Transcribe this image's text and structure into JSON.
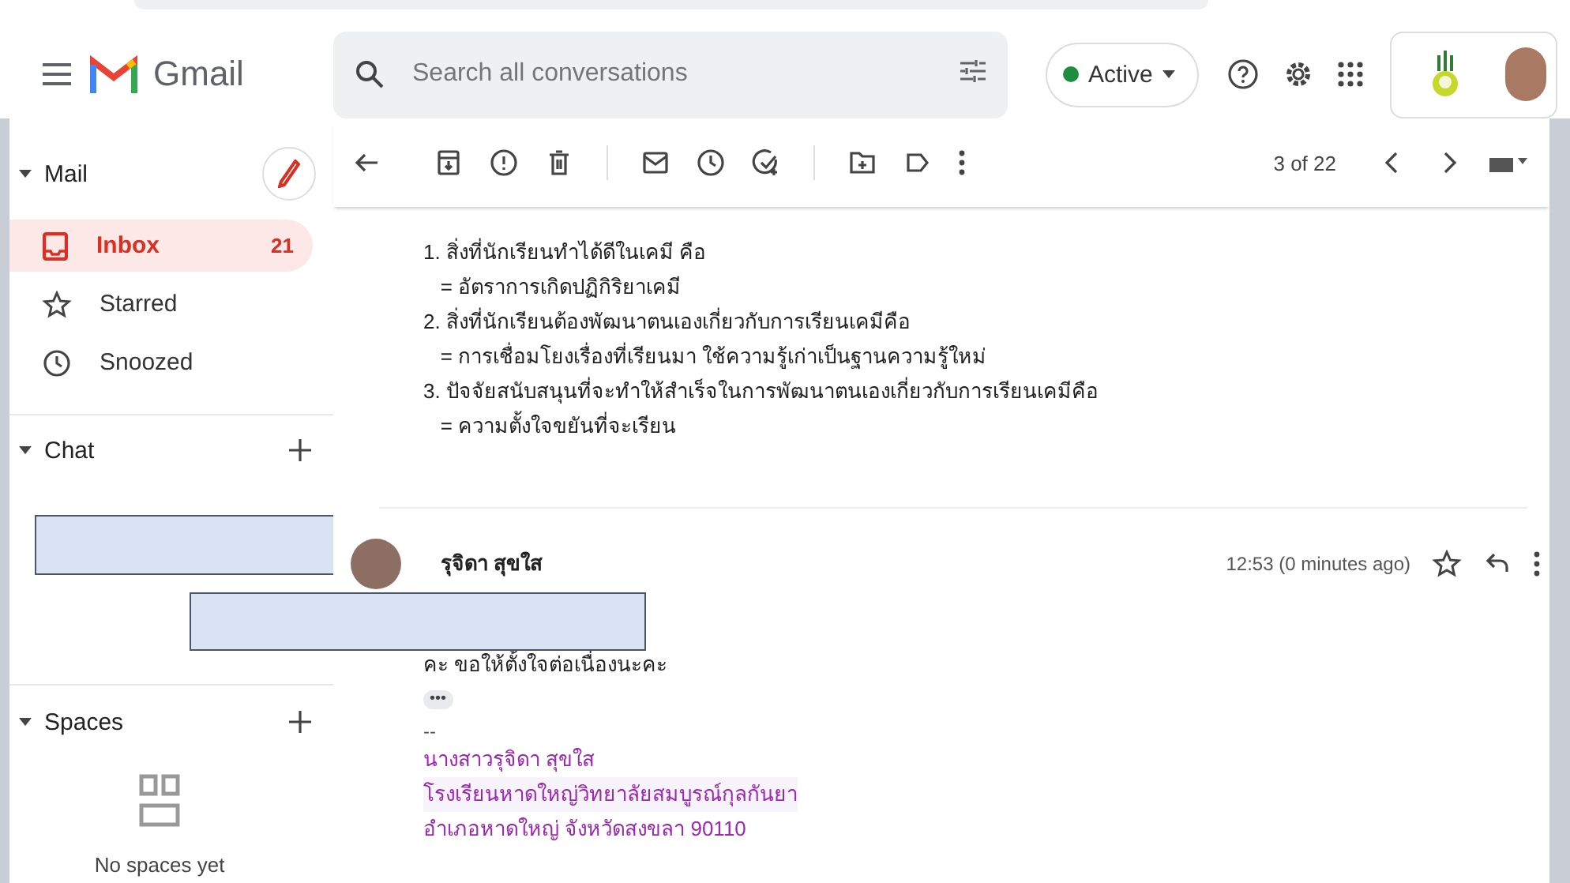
{
  "header": {
    "app_name": "Gmail",
    "search": {
      "placeholder": "Search all conversations"
    },
    "status": {
      "label": "Active"
    }
  },
  "sidebar": {
    "mail_section": {
      "label": "Mail",
      "expanded": true
    },
    "items": [
      {
        "kind": "inbox",
        "label": "Inbox",
        "count": "21",
        "selected": true
      },
      {
        "kind": "star",
        "label": "Starred",
        "selected": false
      },
      {
        "kind": "clock",
        "label": "Snoozed",
        "selected": false
      }
    ],
    "chat_section": {
      "label": "Chat",
      "expanded": true
    },
    "spaces_section": {
      "label": "Spaces",
      "expanded": true,
      "empty_text": "No spaces yet"
    }
  },
  "toolbar": {
    "position": "3 of 22"
  },
  "thread": {
    "quoted_lines": [
      "1. สิ่งที่นักเรียนทำได้ดีในเคมี คือ",
      "   = อัตราการเกิดปฏิกิริยาเคมี",
      "2. สิ่งที่นักเรียนต้องพัฒนาตนเองเกี่ยวกับการเรียนเคมีคือ",
      "   = การเชื่อมโยงเรื่องที่เรียนมา ใช้ความรู้เก่าเป็นฐานความรู้ใหม่",
      "3. ปัจจัยสนับสนุนที่จะทำให้สำเร็จในการพัฒนาตนเองเกี่ยวกับการเรียนเคมีคือ",
      "   = ความตั้งใจขยันที่จะเรียน"
    ],
    "message": {
      "sender": "รุจิดา สุขใส",
      "time": "12:53 (0 minutes ago)",
      "starred": false,
      "body": "คะ ขอให้ตั้งใจต่อเนื่องนะคะ",
      "trimmed_label": "•••",
      "signature_separator": "--",
      "signature": [
        "นางสาวรุจิดา  สุขใส",
        "โรงเรียนหาดใหญ่วิทยาลัยสมบูรณ์กุลกันยา",
        "อำเภอหาดใหญ่ จังหวัดสงขลา  90110"
      ]
    }
  }
}
